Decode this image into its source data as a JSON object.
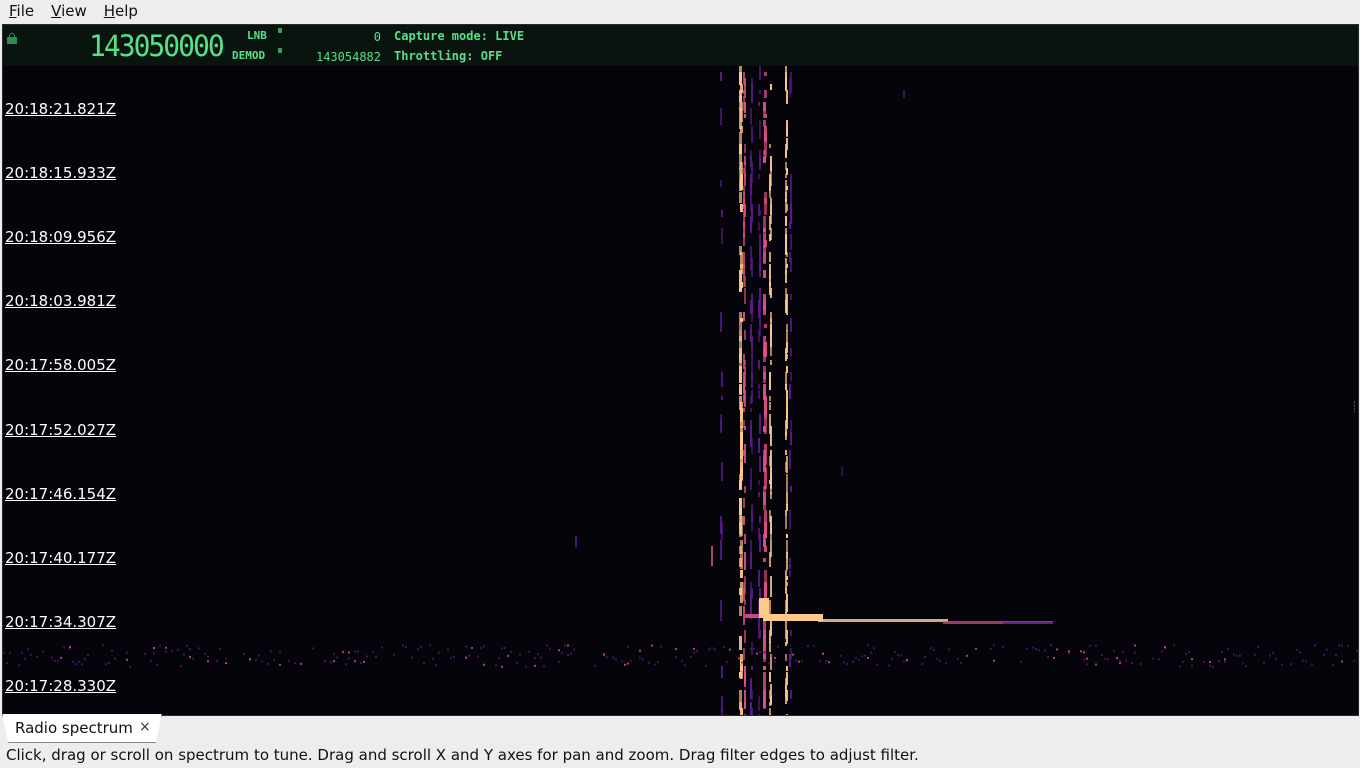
{
  "menu": {
    "items": [
      "File",
      "View",
      "Help"
    ]
  },
  "header": {
    "frequency": "143050000",
    "lnb_label": "LNB",
    "lnb_value": "0",
    "demod_label": "DEMOD",
    "demod_value": "143054882",
    "capture_mode": "Capture mode: LIVE",
    "throttling": "Throttling: OFF"
  },
  "waterfall": {
    "timestamps": [
      "20:18:21.821Z",
      "20:18:15.933Z",
      "20:18:09.956Z",
      "20:18:03.981Z",
      "20:17:58.005Z",
      "20:17:52.027Z",
      "20:17:46.154Z",
      "20:17:40.177Z",
      "20:17:34.307Z",
      "20:17:28.330Z"
    ]
  },
  "tab": {
    "label": "Radio spectrum",
    "close_icon": "×"
  },
  "statusbar": {
    "text": "Click, drag or scroll on spectrum to tune. Drag and scroll X and Y axes for pan and zoom. Drag filter edges to adjust filter."
  },
  "colors": {
    "lcd_green": "#55e08a",
    "waterfall_bg": "#04040a",
    "signal_hot": "#ffc98a",
    "signal_mid": "#e0508a",
    "signal_low": "#5a1a8a"
  }
}
